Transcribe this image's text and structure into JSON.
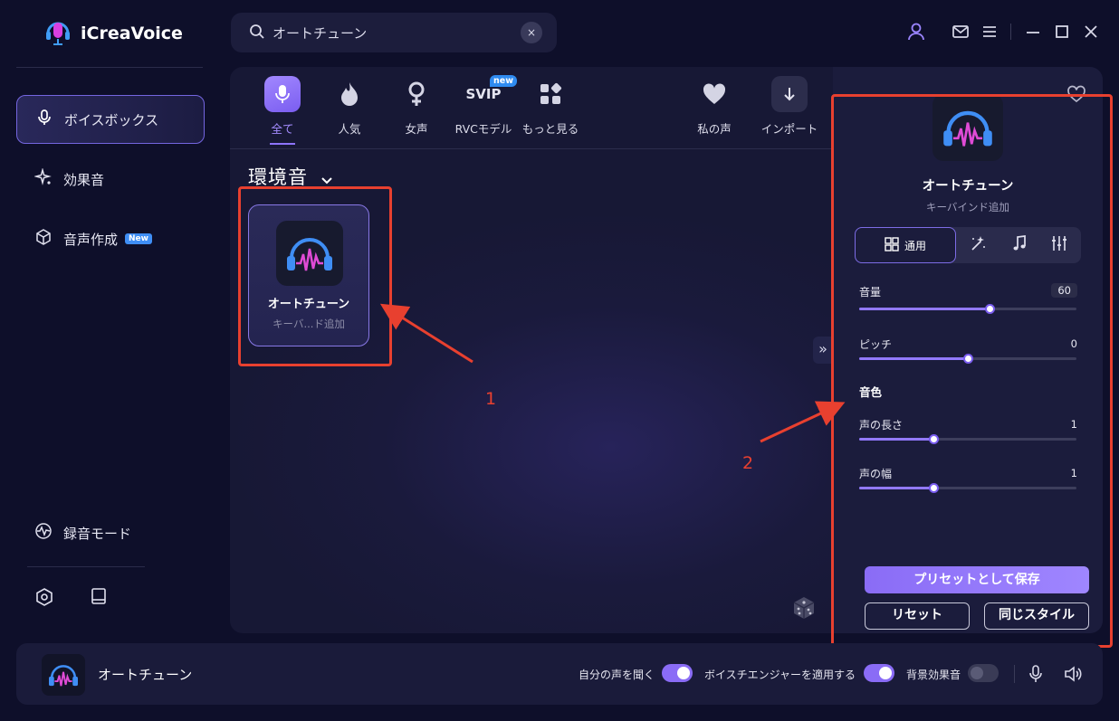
{
  "app": {
    "title": "iCreaVoice"
  },
  "search": {
    "value": "オートチューン",
    "clear_icon": "×"
  },
  "window_controls": [
    "user-icon",
    "mail-icon",
    "menu-icon",
    "minimize-icon",
    "maximize-icon",
    "close-icon"
  ],
  "sidebar": {
    "items": [
      {
        "label": "ボイスボックス",
        "icon": "microphone-icon",
        "active": true
      },
      {
        "label": "効果音",
        "icon": "sparkle-icon"
      },
      {
        "label": "音声作成",
        "icon": "cube-icon",
        "badge": "New"
      },
      {
        "label": "録音モード",
        "icon": "waveform-icon"
      }
    ],
    "bottom_icons": [
      "settings-icon",
      "book-icon"
    ]
  },
  "categories": [
    {
      "label": "全て",
      "icon": "microphone-icon",
      "active": true
    },
    {
      "label": "人気",
      "icon": "fire-icon"
    },
    {
      "label": "女声",
      "icon": "female-icon"
    },
    {
      "label": "RVCモデル",
      "icon": "svip-icon",
      "badge": "new",
      "icon_text": "SVIP"
    },
    {
      "label": "もっと見る",
      "icon": "grid-icon"
    },
    {
      "label": "私の声",
      "icon": "heart-icon"
    },
    {
      "label": "インポート",
      "icon": "download-icon"
    }
  ],
  "section": {
    "title": "環境音"
  },
  "voice_card": {
    "title": "オートチューン",
    "subtitle": "キーバ...ド追加"
  },
  "right_panel": {
    "title": "オートチューン",
    "subtitle": "キーバインド追加",
    "tabs": [
      {
        "label": "通用",
        "icon": "grid-icon",
        "active": true
      },
      {
        "icon": "magic-wand-icon"
      },
      {
        "icon": "music-note-icon"
      },
      {
        "icon": "equalizer-icon"
      }
    ],
    "sliders": [
      {
        "label": "音量",
        "value": "60",
        "fraction": 0.6
      },
      {
        "label": "ピッチ",
        "value": "0",
        "fraction": 0.5
      }
    ],
    "group": {
      "label": "音色"
    },
    "group_sliders": [
      {
        "label": "声の長さ",
        "value": "1",
        "fraction": 0.34
      },
      {
        "label": "声の幅",
        "value": "1",
        "fraction": 0.34
      }
    ],
    "buttons": {
      "save": "プリセットとして保存",
      "reset": "リセット",
      "same_style": "同じスタイル"
    }
  },
  "annotations": {
    "one": "1",
    "two": "2"
  },
  "footer": {
    "title": "オートチューン",
    "listen_label": "自分の声を聞く",
    "listen_on": true,
    "engine_label": "ボイスチエンジャーを適用する",
    "engine_on": true,
    "bg_label": "背景効果音",
    "bg_on": false
  },
  "colors": {
    "accent": "#8a6cf6",
    "annotation_red": "#e8402f",
    "background": "#0e0f2a"
  }
}
